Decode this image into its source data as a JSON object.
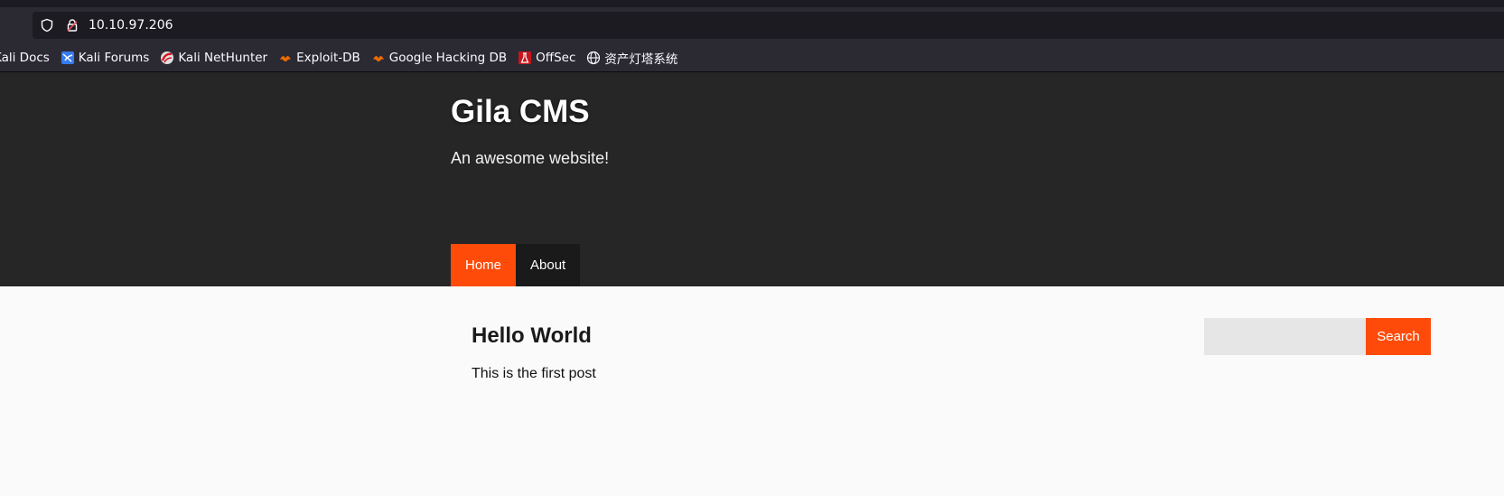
{
  "browser": {
    "url": "10.10.97.206",
    "bookmarks": [
      {
        "label": "Kali Docs",
        "icon": "kali-docs-icon"
      },
      {
        "label": "Kali Forums",
        "icon": "kali-forums-icon"
      },
      {
        "label": "Kali NetHunter",
        "icon": "kali-nethunter-icon"
      },
      {
        "label": "Exploit-DB",
        "icon": "exploit-db-icon"
      },
      {
        "label": "Google Hacking DB",
        "icon": "google-hacking-db-icon"
      },
      {
        "label": "OffSec",
        "icon": "offsec-icon"
      },
      {
        "label": "资产灯塔系统",
        "icon": "globe-icon"
      }
    ]
  },
  "site": {
    "title": "Gila CMS",
    "tagline": "An awesome website!",
    "nav": [
      {
        "label": "Home",
        "active": true
      },
      {
        "label": "About",
        "active": false
      }
    ]
  },
  "post": {
    "title": "Hello World",
    "body": "This is the first post"
  },
  "search": {
    "value": "",
    "button_label": "Search"
  },
  "colors": {
    "accent": "#ff4b0a",
    "header_bg": "#262626",
    "page_bg": "#fafafa",
    "browser_bg": "#2b2a33"
  }
}
